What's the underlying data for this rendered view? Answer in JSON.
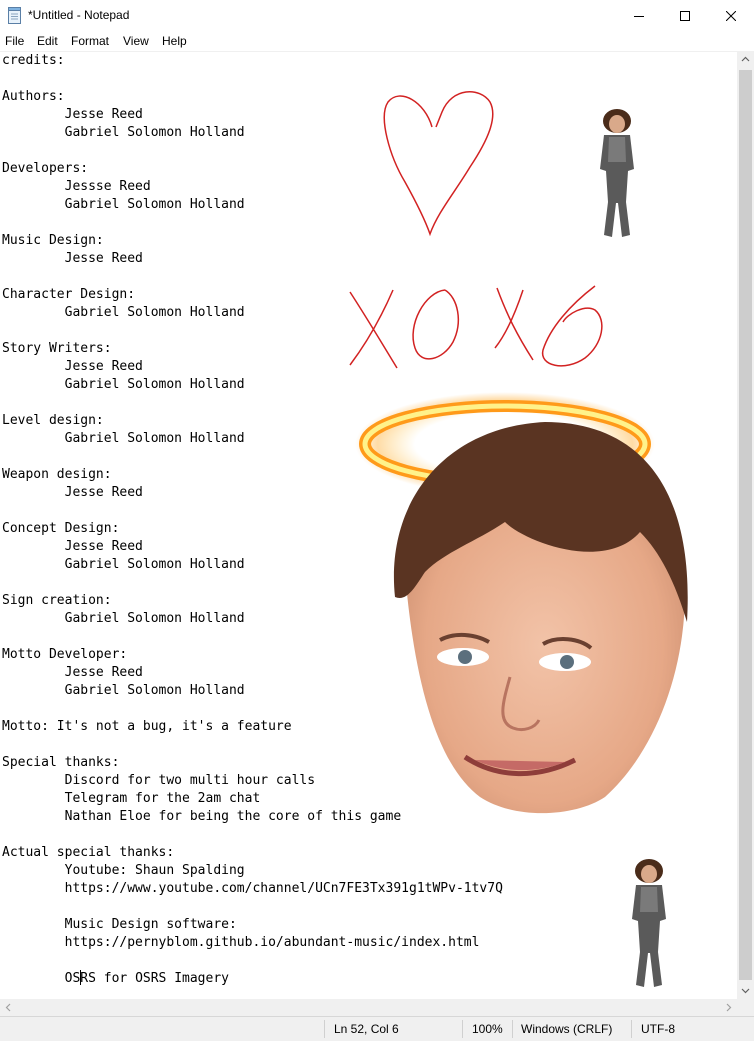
{
  "window": {
    "title": "*Untitled - Notepad",
    "minimize_glyph": "—",
    "maximize_glyph": "☐",
    "close_glyph": "✕"
  },
  "menu": {
    "items": [
      {
        "label": "File"
      },
      {
        "label": "Edit"
      },
      {
        "label": "Format"
      },
      {
        "label": "View"
      },
      {
        "label": "Help"
      }
    ]
  },
  "editor": {
    "lines": [
      "credits:",
      "",
      "Authors:",
      "        Jesse Reed",
      "        Gabriel Solomon Holland",
      "",
      "Developers:",
      "        Jessse Reed",
      "        Gabriel Solomon Holland",
      "",
      "Music Design:",
      "        Jesse Reed",
      "",
      "Character Design:",
      "        Gabriel Solomon Holland",
      "",
      "Story Writers:",
      "        Jesse Reed",
      "        Gabriel Solomon Holland",
      "",
      "Level design:",
      "        Gabriel Solomon Holland",
      "",
      "Weapon design:",
      "        Jesse Reed",
      "",
      "Concept Design:",
      "        Jesse Reed",
      "        Gabriel Solomon Holland",
      "",
      "Sign creation:",
      "        Gabriel Solomon Holland",
      "",
      "Motto Developer:",
      "        Jesse Reed",
      "        Gabriel Solomon Holland",
      "",
      "Motto: It's not a bug, it's a feature",
      "",
      "Special thanks:",
      "        Discord for two multi hour calls",
      "        Telegram for the 2am chat",
      "        Nathan Eloe for being the core of this game",
      "",
      "Actual special thanks:",
      "        Youtube: Shaun Spalding",
      "        https://www.youtube.com/channel/UCn7FE3Tx391g1tWPv-1tv7Q",
      "",
      "        Music Design software:",
      "        https://pernyblom.github.io/abundant-music/index.html",
      "",
      "        OSRS for OSRS Imagery"
    ],
    "caret_line": 51,
    "caret_col": 6
  },
  "status": {
    "position": "Ln 52, Col 6",
    "zoom": "100%",
    "line_endings": "Windows (CRLF)",
    "encoding": "UTF-8"
  },
  "overlays": {
    "doodle_text": "XO XO",
    "doodle_color": "#d22222",
    "halo_color": "#ffd21a"
  }
}
